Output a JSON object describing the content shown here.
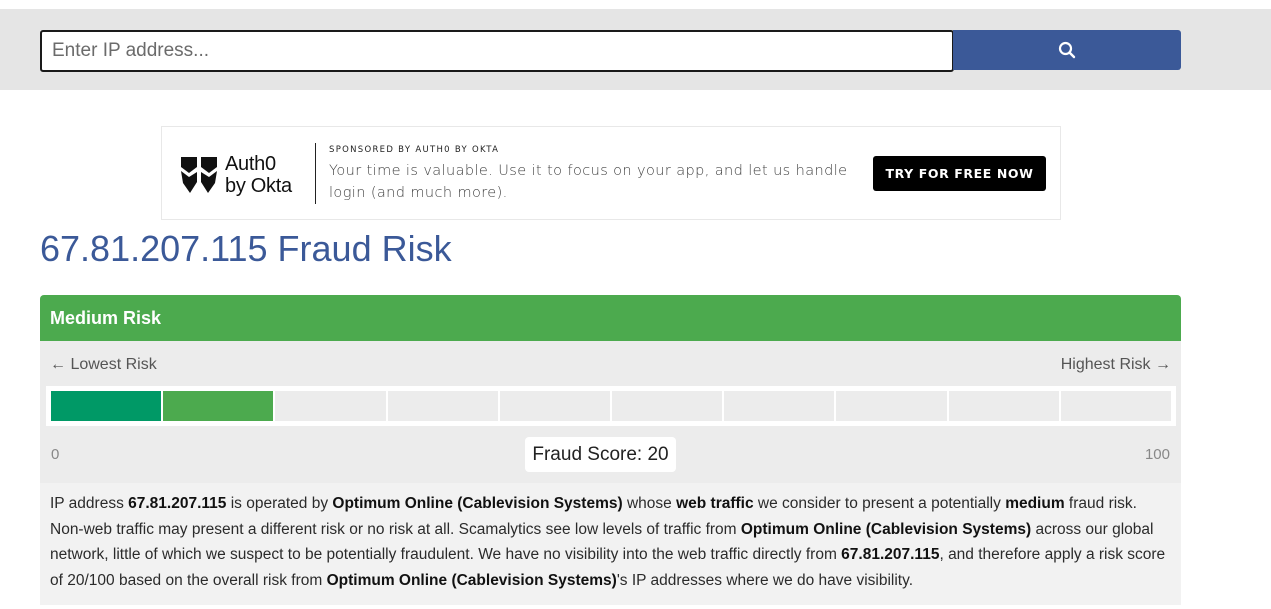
{
  "search": {
    "placeholder": "Enter IP address...",
    "button_icon": "search-icon",
    "button_color": "#3b5998"
  },
  "ad": {
    "brand_line1": "Auth0",
    "brand_line2": "by Okta",
    "sponsor_label": "SPONSORED BY AUTH0 BY OKTA",
    "text": "Your time is valuable. Use it to focus on your app, and let us handle login (and much more).",
    "cta_label": "TRY FOR FREE NOW"
  },
  "page": {
    "title": "67.81.207.115 Fraud Risk",
    "title_color": "#3b5998"
  },
  "risk": {
    "level_label": "Medium Risk",
    "level_color": "#4caa4e",
    "low_label": "← Lowest Risk",
    "high_label": "Highest Risk →",
    "scale_min": "0",
    "scale_max": "100",
    "score_label": "Fraud Score: 20",
    "score_value": 20,
    "segments_total": 10,
    "segments_filled": 2,
    "fill_colors": [
      "#009966",
      "#4caa4e"
    ]
  },
  "description": {
    "p1": "IP address ",
    "ip": "67.81.207.115",
    "p2": " is operated by ",
    "isp": "Optimum Online (Cablevision Systems)",
    "p3": " whose ",
    "traffic": "web traffic",
    "p4": " we consider to present a potentially ",
    "level": "medium",
    "p5": " fraud risk. Non-web traffic may present a different risk or no risk at all. Scamalytics see low levels of traffic from ",
    "p6": " across our global network, little of which we suspect to be potentially fraudulent. We have no visibility into the web traffic directly from ",
    "p7": ", and therefore apply a risk score of 20/100 based on the overall risk from ",
    "p8": "'s IP addresses where we do have visibility."
  }
}
